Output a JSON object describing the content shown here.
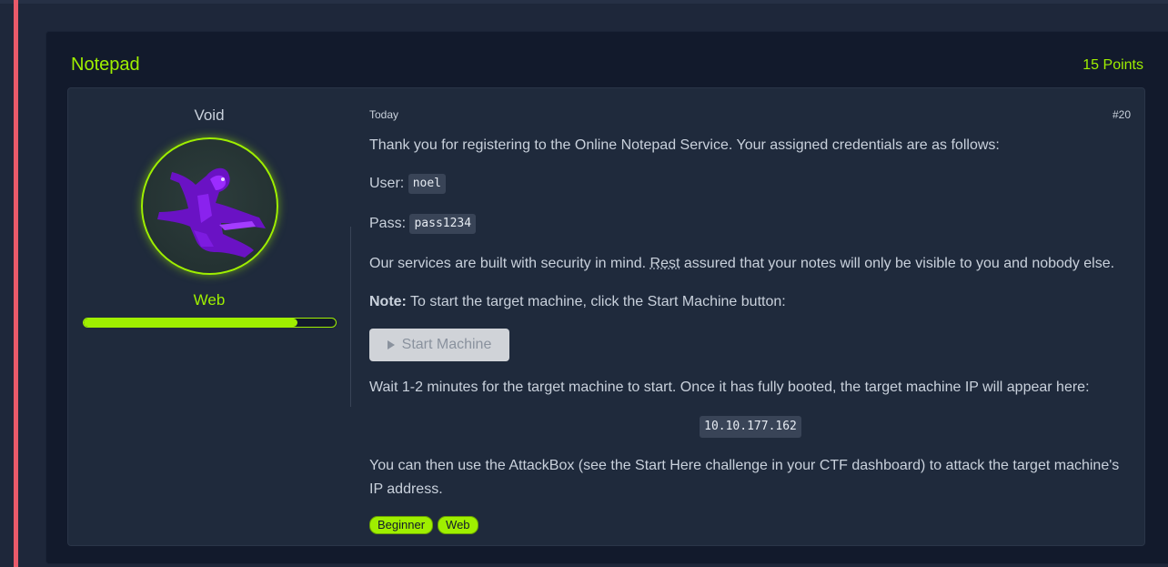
{
  "challenge": {
    "title": "Notepad",
    "points": "15 Points"
  },
  "author": {
    "name": "Void",
    "category": "Web",
    "progress_percent": 85
  },
  "post": {
    "date": "Today",
    "number": "#20",
    "intro": "Thank you for registering to the Online Notepad Service. Your assigned credentials are as follows:",
    "user_label": "User:",
    "user_value": "noel",
    "pass_label": "Pass:",
    "pass_value": "pass1234",
    "security_pre": "Our services are built with security in mind. ",
    "security_abbr": "Rest",
    "security_post": " assured that your notes will only be visible to you and nobody else.",
    "note_label": "Note:",
    "note_text": " To start the target machine, click the Start Machine button:",
    "start_button": "Start Machine",
    "wait_text": "Wait 1-2 minutes for the target machine to start. Once it has fully booted, the target machine IP will appear here:",
    "ip": "10.10.177.162",
    "attack_line1": "You can then use the AttackBox (see the Start Here challenge in your CTF dashboard) to attack the target machine's",
    "attack_line2": "IP address.",
    "tags": [
      "Beginner",
      "Web"
    ]
  },
  "colors": {
    "accent": "#9fef00",
    "stripe": "#e95a6a",
    "card_bg": "#121a2c",
    "post_bg": "#1f2a3c"
  }
}
